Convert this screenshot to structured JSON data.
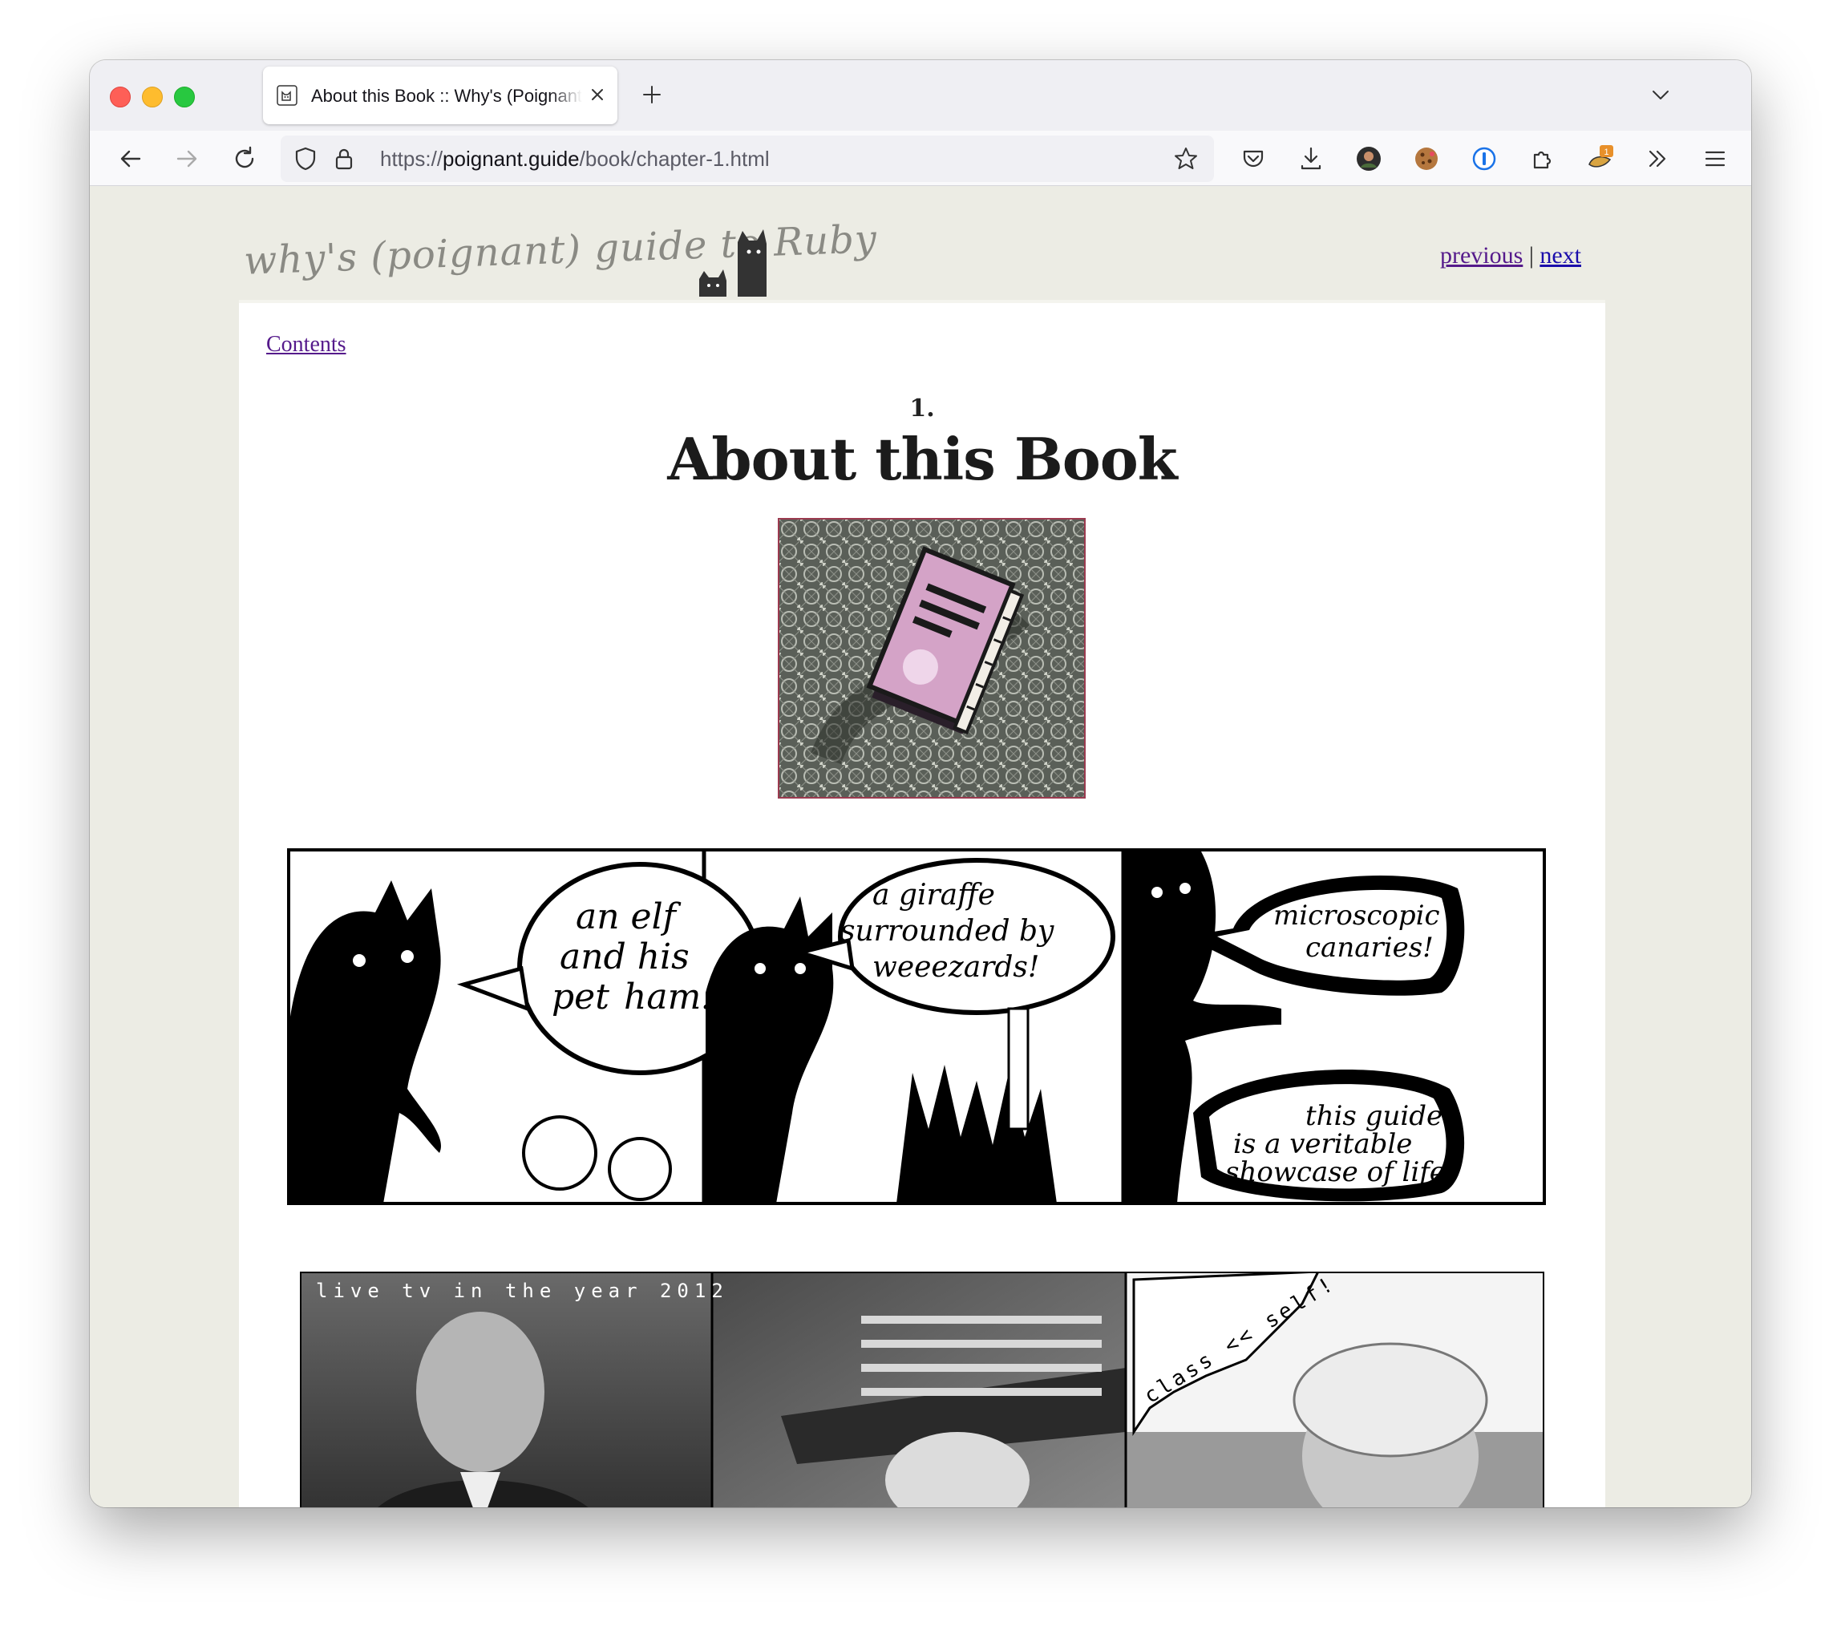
{
  "browser": {
    "tab_title": "About this Book :: Why's (Poignant Guide to Ruby)",
    "url_scheme": "https://",
    "url_host": "poignant.guide",
    "url_path": "/book/chapter-1.html",
    "extension_badge": "1"
  },
  "masthead": {
    "logo_text": "why's (poignant) guide to Ruby",
    "previous_label": "previous",
    "separator": "|",
    "next_label": "next"
  },
  "content": {
    "contents_link": "Contents",
    "chapter_number": "1.",
    "chapter_title": "About this Book"
  },
  "comic1": {
    "panel1": [
      "an elf",
      "and his",
      "pet",
      "ham!"
    ],
    "panel2": [
      "a giraffe",
      "surrounded by",
      "weeezards!"
    ],
    "panel3_top": [
      "microscopic",
      "canaries!"
    ],
    "panel3_bottom": [
      "this guide",
      "is a veritable",
      "showcase of life!"
    ]
  },
  "comic2": {
    "panel1_caption": "live tv in the year 2012",
    "panel3_caption": "class << self!"
  }
}
